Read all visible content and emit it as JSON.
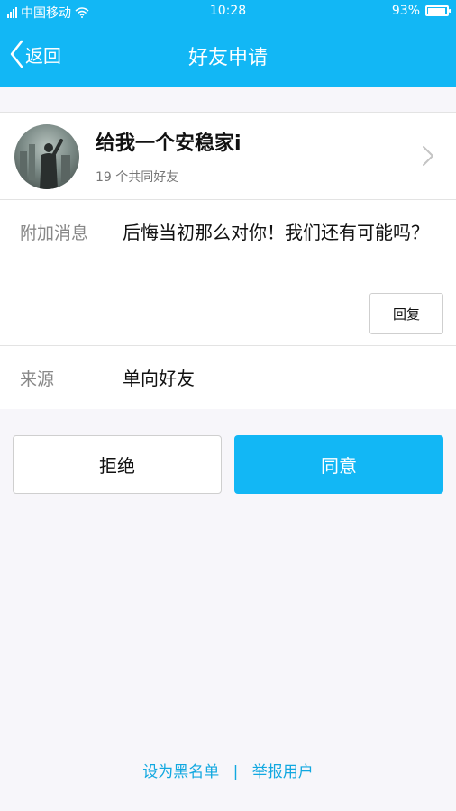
{
  "status_bar": {
    "carrier": "中国移动",
    "time": "10:28",
    "battery_text": "93%",
    "battery_level": 0.93,
    "icons": [
      "signal-icon",
      "wifi-icon",
      "battery-icon"
    ]
  },
  "navbar": {
    "back_label": "返回",
    "title": "好友申请"
  },
  "profile": {
    "nickname": "给我一个安稳家i",
    "mutual_friends": "19 个共同好友"
  },
  "message": {
    "label": "附加消息",
    "text": "后悔当初那么对你！我们还有可能吗？",
    "reply_label": "回复"
  },
  "source": {
    "label": "来源",
    "value": "单向好友"
  },
  "actions": {
    "reject_label": "拒绝",
    "accept_label": "同意"
  },
  "footer": {
    "blacklist_label": "设为黑名单",
    "separator": "|",
    "report_label": "举报用户"
  },
  "colors": {
    "accent": "#12b7f5",
    "background": "#f7f6fa",
    "link": "#12a8e0"
  }
}
